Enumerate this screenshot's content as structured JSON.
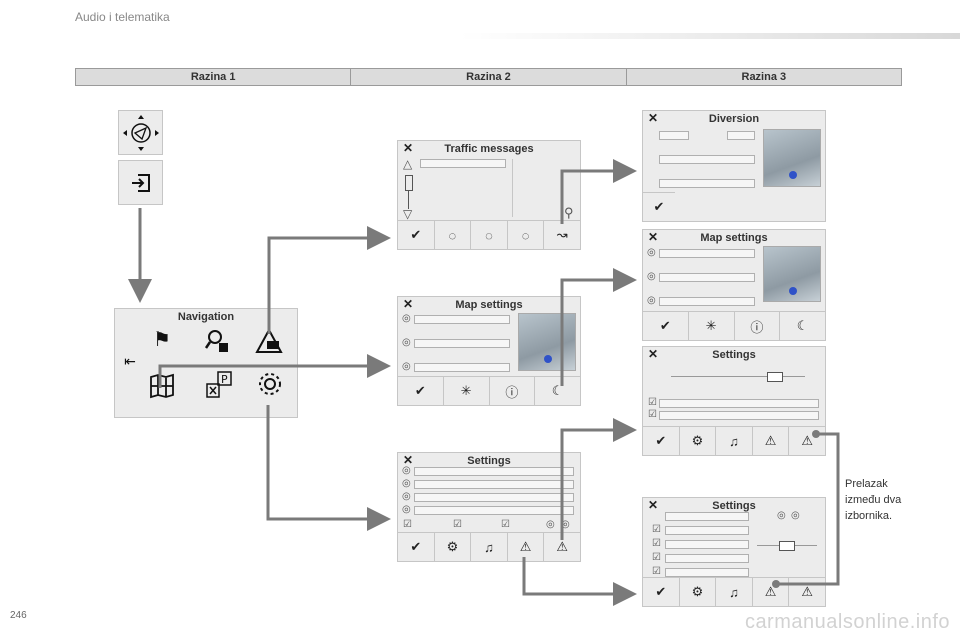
{
  "header": {
    "section": "Audio i telematika"
  },
  "levels": [
    "Razina 1",
    "Razina 2",
    "Razina 3"
  ],
  "panels": {
    "navigation": {
      "title": "Navigation"
    },
    "traffic": {
      "title": "Traffic messages"
    },
    "map2": {
      "title": "Map settings"
    },
    "settings2": {
      "title": "Settings"
    },
    "diversion": {
      "title": "Diversion"
    },
    "map3": {
      "title": "Map settings"
    },
    "settings3a": {
      "title": "Settings"
    },
    "settings3b": {
      "title": "Settings"
    }
  },
  "icons": {
    "close": "✕",
    "confirm": "✔",
    "info": "ⓘ",
    "warning": "⚠",
    "radio": "◎",
    "checkbox": "☑"
  },
  "note": "Prelazak između dva izbornika.",
  "page_number": "246",
  "watermark": "carmanualsonline.info",
  "colors": {
    "panel": "#ececec",
    "arrow": "#7a7a7a"
  }
}
